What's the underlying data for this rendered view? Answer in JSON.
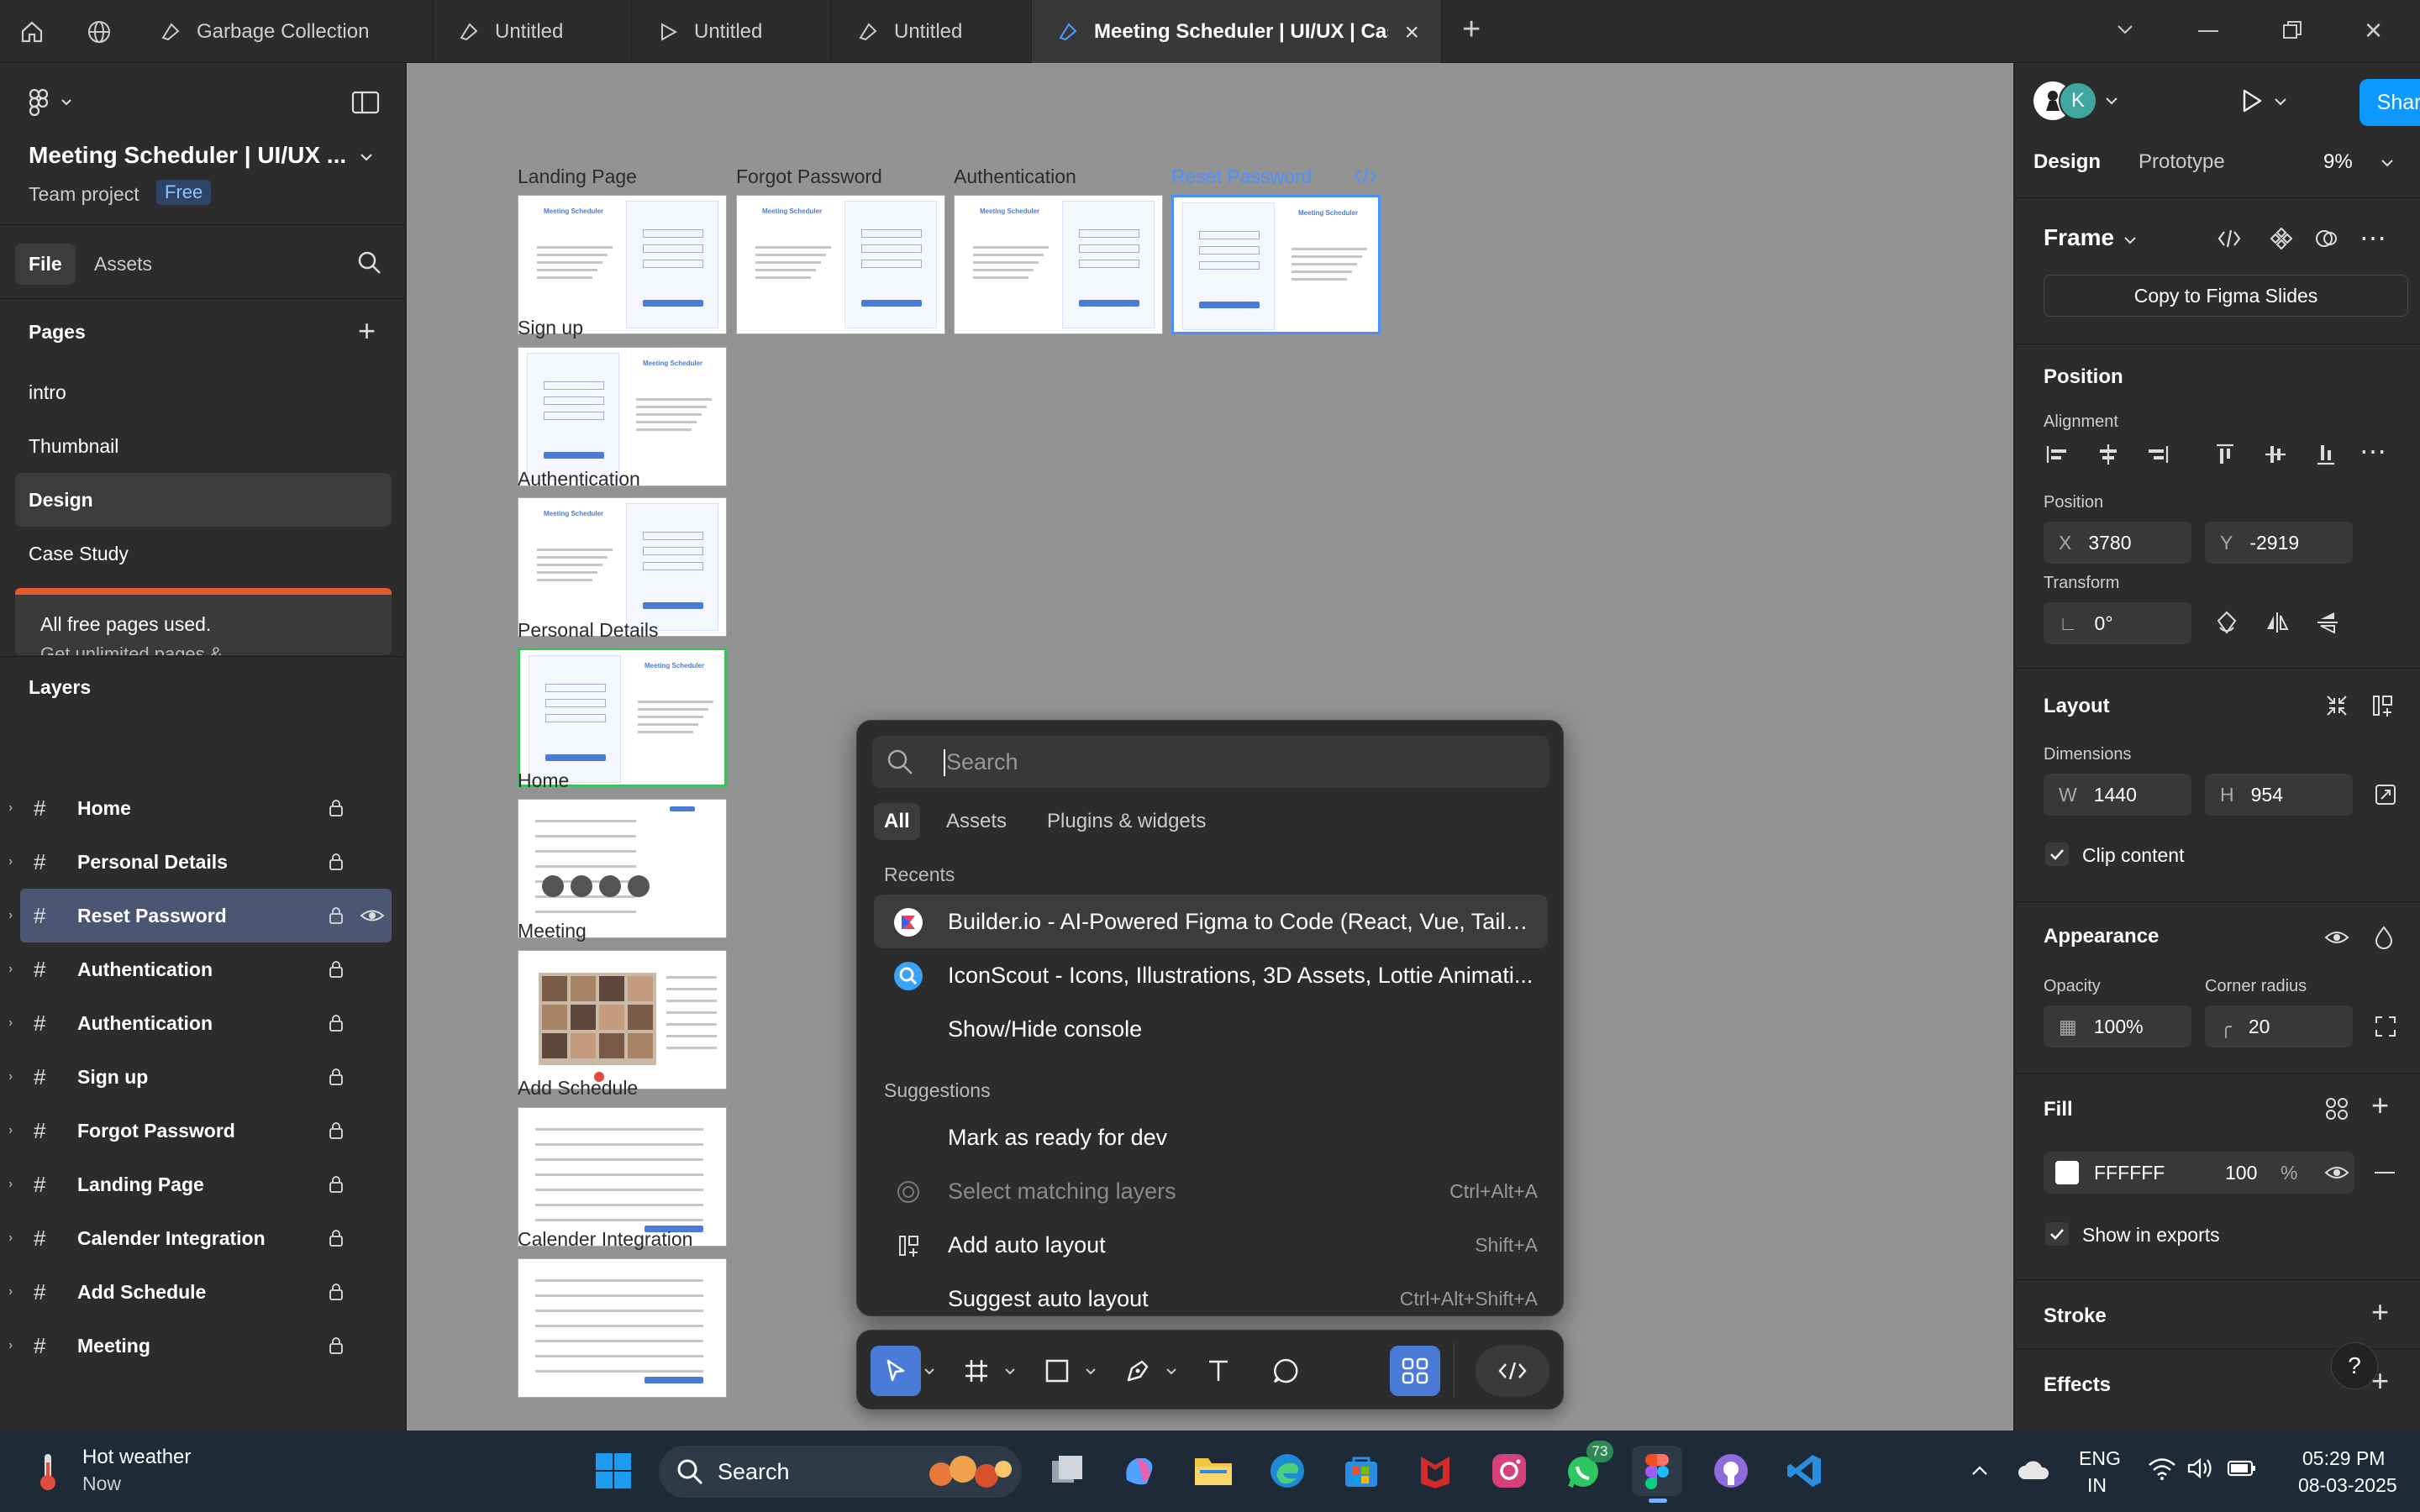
{
  "tabs": [
    {
      "label": "Garbage Collection"
    },
    {
      "label": "Untitled"
    },
    {
      "label": "Untitled"
    },
    {
      "label": "Untitled"
    },
    {
      "label": "Meeting Scheduler | UI/UX | Case"
    }
  ],
  "file": {
    "title": "Meeting Scheduler | UI/UX ...",
    "team": "Team project",
    "plan_badge": "Free",
    "tabs": [
      "File",
      "Assets"
    ]
  },
  "pages": {
    "heading": "Pages",
    "items": [
      "intro",
      "Thumbnail",
      "Design",
      "Case Study"
    ],
    "notice": "All free pages used.",
    "notice_sub": "Get unlimited pages &"
  },
  "layers": {
    "heading": "Layers",
    "items": [
      "Home",
      "Personal Details",
      "Reset Password",
      "Authentication",
      "Authentication",
      "Sign up",
      "Forgot Password",
      "Landing Page",
      "Calender Integration",
      "Add Schedule",
      "Meeting"
    ]
  },
  "canvas": {
    "frame_labels": [
      "Landing Page",
      "Forgot Password",
      "Authentication",
      "Reset Password",
      "Sign up",
      "Authentication",
      "Personal Details",
      "Home",
      "Meeting",
      "Add Schedule",
      "Calender Integration"
    ],
    "thumb_brand": "Meeting Scheduler"
  },
  "quick_actions": {
    "search_placeholder": "Search",
    "filters": [
      "All",
      "Assets",
      "Plugins & widgets"
    ],
    "recents_heading": "Recents",
    "recents": [
      "Builder.io - AI-Powered Figma to Code (React, Vue, Tailw...",
      "IconScout - Icons, Illustrations, 3D Assets, Lottie Animati...",
      "Show/Hide console"
    ],
    "suggestions_heading": "Suggestions",
    "suggestions": [
      {
        "label": "Mark as ready for dev",
        "shortcut": ""
      },
      {
        "label": "Select matching layers",
        "shortcut": "Ctrl+Alt+A"
      },
      {
        "label": "Add auto layout",
        "shortcut": "Shift+A"
      },
      {
        "label": "Suggest auto layout",
        "shortcut": "Ctrl+Alt+Shift+A"
      }
    ]
  },
  "right": {
    "avatar_letter": "K",
    "share": "Share",
    "tabs": [
      "Design",
      "Prototype"
    ],
    "zoom": "9%",
    "frame_label": "Frame",
    "copy_btn": "Copy to Figma Slides",
    "position_heading": "Position",
    "alignment_label": "Alignment",
    "position_label": "Position",
    "x_label": "X",
    "x": "3780",
    "y_label": "Y",
    "y": "-2919",
    "transform_label": "Transform",
    "rotation": "0°",
    "layout_heading": "Layout",
    "dimensions_label": "Dimensions",
    "w_label": "W",
    "w": "1440",
    "h_label": "H",
    "h": "954",
    "clip_content": "Clip content",
    "appearance_heading": "Appearance",
    "opacity_label": "Opacity",
    "opacity": "100%",
    "radius_label": "Corner radius",
    "radius": "20",
    "fill_heading": "Fill",
    "fill_hex": "FFFFFF",
    "fill_opacity": "100",
    "fill_pct": "%",
    "show_exports": "Show in exports",
    "stroke_heading": "Stroke",
    "effects_heading": "Effects"
  },
  "taskbar": {
    "weather_title": "Hot weather",
    "weather_sub": "Now",
    "search": "Search",
    "whatsapp_badge": "73",
    "lang1": "ENG",
    "lang2": "IN",
    "time": "05:29 PM",
    "date": "08-03-2025"
  },
  "colors": {
    "accent": "#4a7bd9",
    "share_blue": "#0d99ff",
    "selected_layer": "#4b5772",
    "canvas": "#939393"
  }
}
